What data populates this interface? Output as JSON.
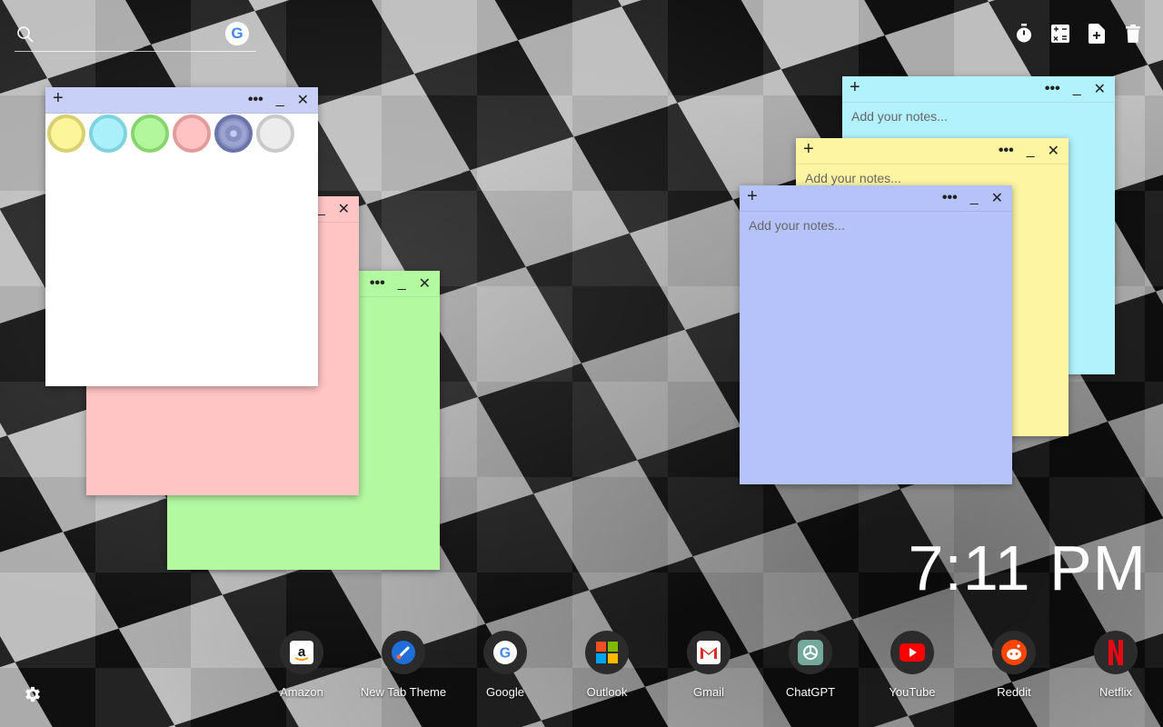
{
  "search": {
    "placeholder": "",
    "google_letter": "G"
  },
  "toolbar": {
    "timer": "timer-icon",
    "calculator": "calculator-icon",
    "new_note": "new-note-icon",
    "delete": "trash-icon"
  },
  "notes": {
    "placeholder": "Add your notes...",
    "plus": "+",
    "more": "•••",
    "minimize": "_",
    "close": "✕"
  },
  "palette": [
    {
      "name": "yellow",
      "fill": "#fdf59a",
      "border": "#d8d070"
    },
    {
      "name": "cyan",
      "fill": "#aaf0fb",
      "border": "#7fd3de"
    },
    {
      "name": "green",
      "fill": "#b3f79c",
      "border": "#86d56f"
    },
    {
      "name": "pink",
      "fill": "#ffc3c3",
      "border": "#e39c9c"
    },
    {
      "name": "blue",
      "fill": "#8790c0",
      "border": "#6b74a8"
    },
    {
      "name": "white",
      "fill": "#ececec",
      "border": "#c9c9c9"
    }
  ],
  "clock": {
    "time": "7:11 PM"
  },
  "dock": [
    {
      "label": "Amazon",
      "icon": "amazon-icon"
    },
    {
      "label": "New Tab Theme",
      "icon": "new-tab-theme-icon"
    },
    {
      "label": "Google",
      "icon": "google-icon"
    },
    {
      "label": "Outlook",
      "icon": "outlook-icon"
    },
    {
      "label": "Gmail",
      "icon": "gmail-icon"
    },
    {
      "label": "ChatGPT",
      "icon": "chatgpt-icon"
    },
    {
      "label": "YouTube",
      "icon": "youtube-icon"
    },
    {
      "label": "Reddit",
      "icon": "reddit-icon"
    },
    {
      "label": "Netflix",
      "icon": "netflix-icon"
    }
  ],
  "colors": {
    "note_white": "#ffffff",
    "note_white_bar": "#c8d0f7",
    "note_pink": "#ffc4c4",
    "note_green": "#b2f99f",
    "note_cyan": "#b1f2fd",
    "note_yellow": "#fdf5a2",
    "note_blue": "#b6c3fb"
  }
}
